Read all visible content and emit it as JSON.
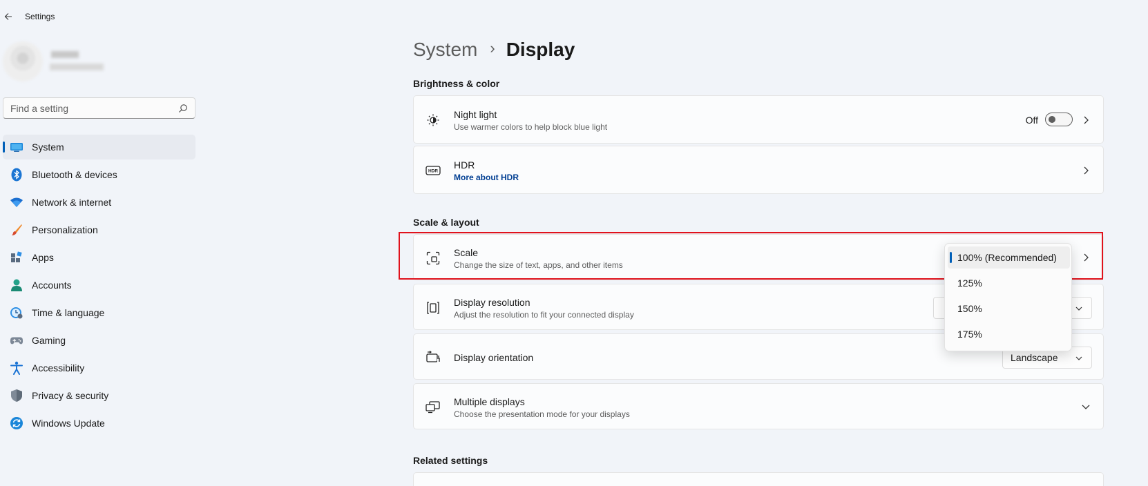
{
  "window": {
    "title": "Settings"
  },
  "search": {
    "placeholder": "Find a setting"
  },
  "nav": {
    "items": [
      {
        "label": "System",
        "icon": "system-icon",
        "active": true
      },
      {
        "label": "Bluetooth & devices",
        "icon": "bluetooth-icon"
      },
      {
        "label": "Network & internet",
        "icon": "wifi-icon"
      },
      {
        "label": "Personalization",
        "icon": "brush-icon"
      },
      {
        "label": "Apps",
        "icon": "apps-icon"
      },
      {
        "label": "Accounts",
        "icon": "account-icon"
      },
      {
        "label": "Time & language",
        "icon": "time-language-icon"
      },
      {
        "label": "Gaming",
        "icon": "gamepad-icon"
      },
      {
        "label": "Accessibility",
        "icon": "accessibility-icon"
      },
      {
        "label": "Privacy & security",
        "icon": "shield-icon"
      },
      {
        "label": "Windows Update",
        "icon": "update-icon"
      }
    ]
  },
  "breadcrumb": {
    "parent": "System",
    "separator": "›",
    "current": "Display"
  },
  "sections": {
    "brightness": "Brightness & color",
    "scale_layout": "Scale & layout",
    "related": "Related settings"
  },
  "cards": {
    "night_light": {
      "title": "Night light",
      "subtitle": "Use warmer colors to help block blue light",
      "toggle_label": "Off",
      "toggle_on": false,
      "icon": "brightness-icon"
    },
    "hdr": {
      "title": "HDR",
      "link": "More about HDR",
      "icon": "hdr-icon"
    },
    "scale": {
      "title": "Scale",
      "subtitle": "Change the size of text, apps, and other items",
      "icon": "scale-icon"
    },
    "resolution": {
      "title": "Display resolution",
      "subtitle": "Adjust the resolution to fit your connected display",
      "icon": "resolution-icon"
    },
    "orientation": {
      "title": "Display orientation",
      "value": "Landscape",
      "icon": "orientation-icon"
    },
    "multiple": {
      "title": "Multiple displays",
      "subtitle": "Choose the presentation mode for your displays",
      "icon": "multiple-displays-icon"
    }
  },
  "scale_flyout": {
    "options": [
      "100% (Recommended)",
      "125%",
      "150%",
      "175%"
    ],
    "selected": "100% (Recommended)"
  },
  "colors": {
    "accent": "#005fb8",
    "highlight": "#e0121c",
    "link": "#003e92"
  }
}
